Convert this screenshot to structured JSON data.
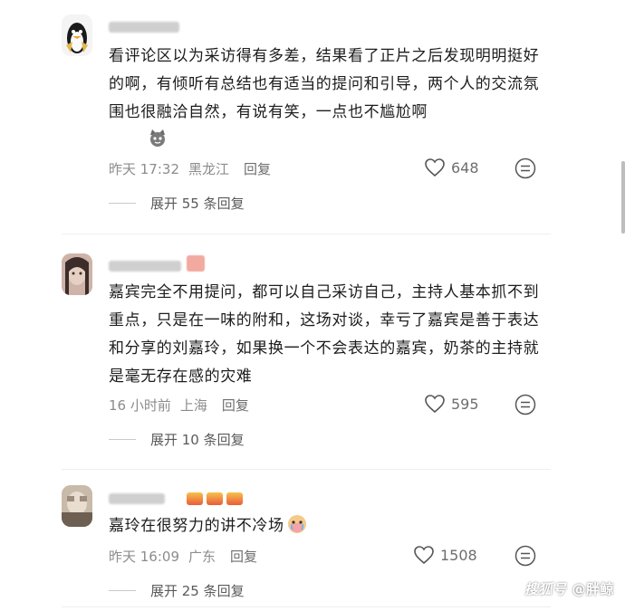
{
  "comments": [
    {
      "text": "看评论区以为采访得有多差，结果看了正片之后发现明明挺好的啊，有倾听有总结也有适当的提问和引导，两个人的交流氛围也很融洽自然，有说有笑，一点也不尴尬啊",
      "time": "昨天 17:32",
      "location": "黑龙江",
      "reply": "回复",
      "likes": "648",
      "expand": "展开 55 条回复"
    },
    {
      "text": "嘉宾完全不用提问，都可以自己采访自己，主持人基本抓不到重点，只是在一味的附和，这场对谈，幸亏了嘉宾是善于表达和分享的刘嘉玲，如果换一个不会表达的嘉宾，奶茶的主持就是毫无存在感的灾难",
      "time": "16 小时前",
      "location": "上海",
      "reply": "回复",
      "likes": "595",
      "expand": "展开 10 条回复"
    },
    {
      "text": "嘉玲在很努力的讲不冷场",
      "time": "昨天 16:09",
      "location": "广东",
      "reply": "回复",
      "likes": "1508",
      "expand": "展开 25 条回复"
    }
  ],
  "watermark": {
    "logo": "搜狐号",
    "author": "@胖鲸"
  },
  "icons": {
    "like": "heart-outline-icon",
    "more": "more-dots-icon",
    "emoji1": "cat-emoji-icon",
    "emoji2": "crying-face-emoji-icon"
  }
}
